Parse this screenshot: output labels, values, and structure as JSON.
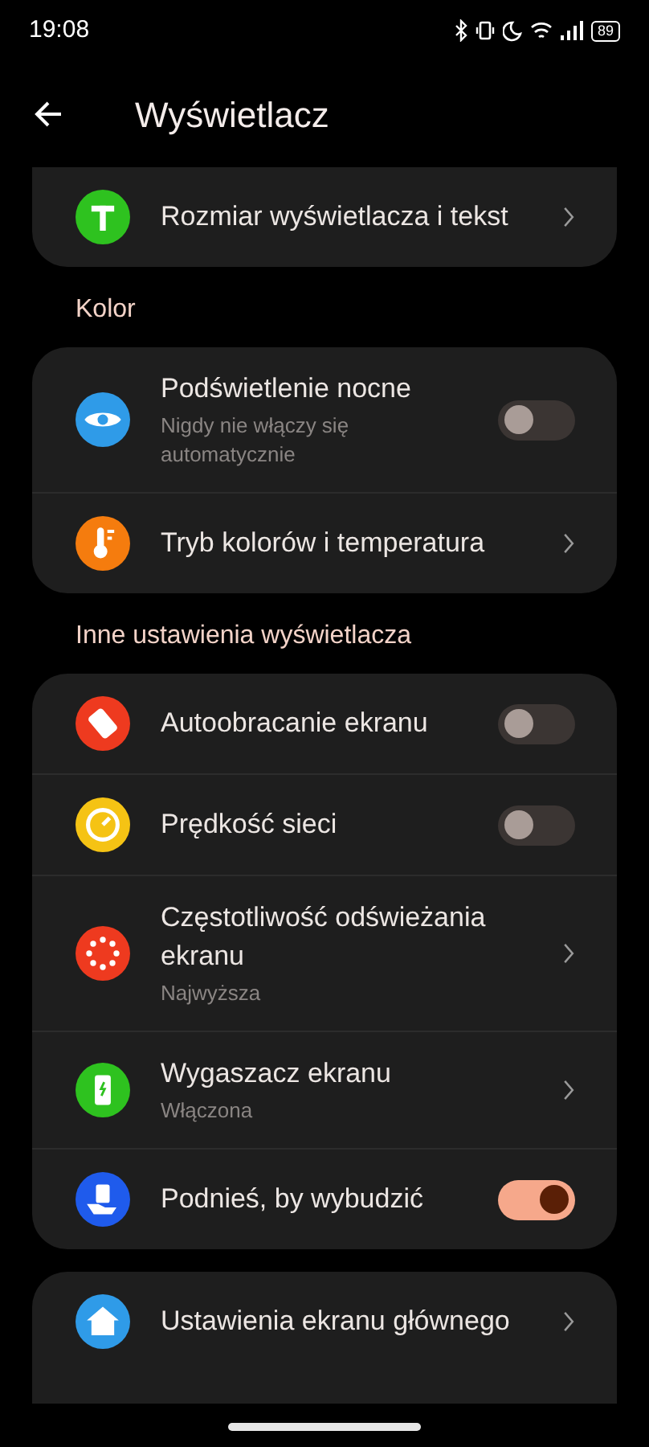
{
  "status_bar": {
    "time": "19:08",
    "battery": "89"
  },
  "header": {
    "title": "Wyświetlacz"
  },
  "sections": [
    {
      "items": [
        {
          "kind": "link",
          "title": "Rozmiar wyświetlacza i tekst"
        }
      ]
    },
    {
      "heading": "Kolor",
      "items": [
        {
          "kind": "toggle",
          "title": "Podświetlenie nocne",
          "subtitle": "Nigdy nie włączy się automatycznie",
          "on": false
        },
        {
          "kind": "link",
          "title": "Tryb kolorów i temperatura"
        }
      ]
    },
    {
      "heading": "Inne ustawienia wyświetlacza",
      "items": [
        {
          "kind": "toggle",
          "title": "Autoobracanie ekranu",
          "on": false
        },
        {
          "kind": "toggle",
          "title": "Prędkość sieci",
          "on": false
        },
        {
          "kind": "link",
          "title": "Częstotliwość odświeżania ekranu",
          "subtitle": "Najwyższa"
        },
        {
          "kind": "link",
          "title": "Wygaszacz ekranu",
          "subtitle": "Włączona"
        },
        {
          "kind": "toggle",
          "title": "Podnieś, by wybudzić",
          "on": true
        }
      ]
    },
    {
      "items": [
        {
          "kind": "link",
          "title": "Ustawienia ekranu głównego"
        }
      ]
    }
  ]
}
